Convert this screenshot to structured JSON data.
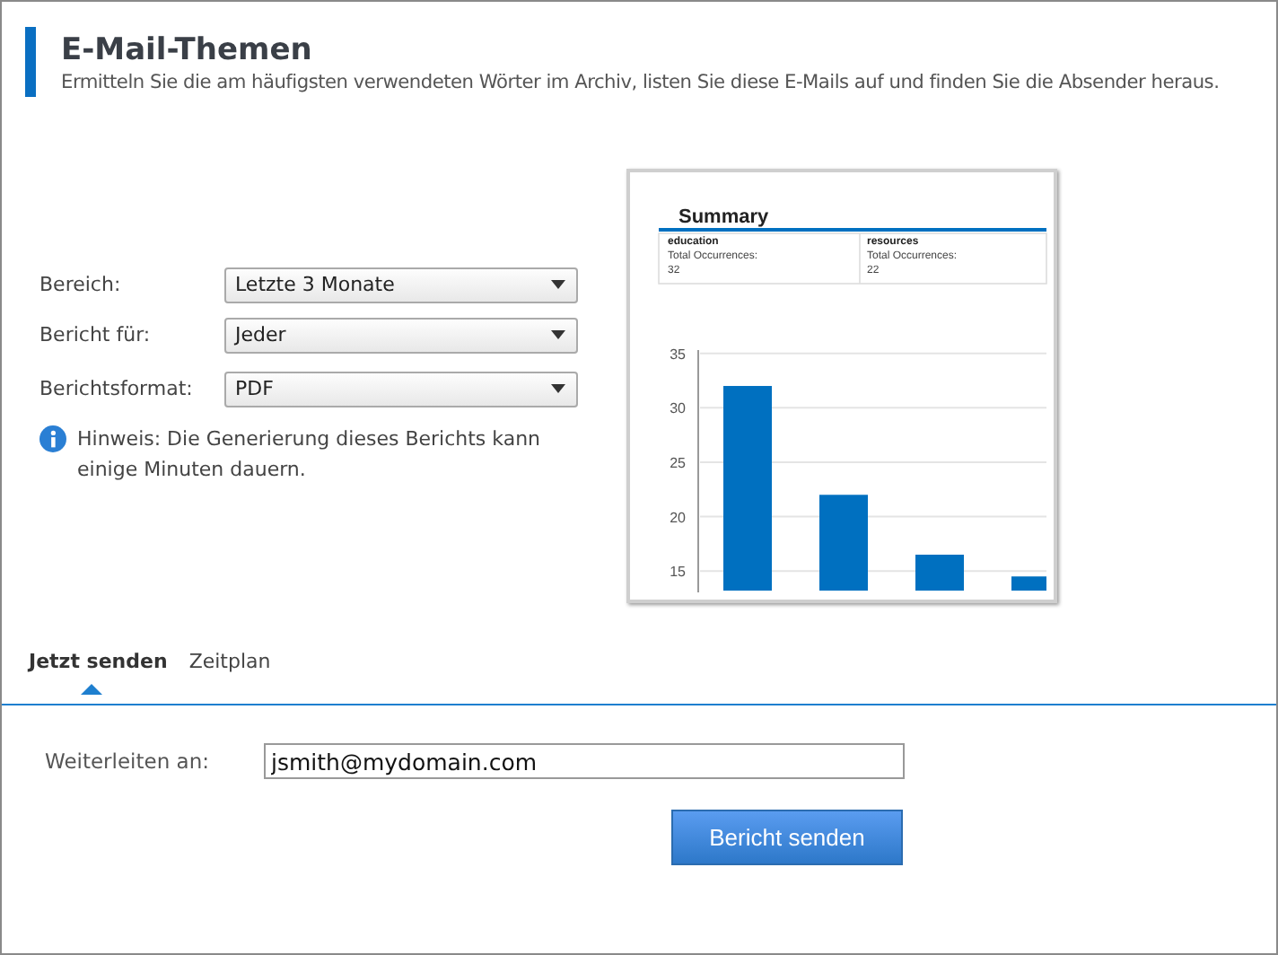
{
  "header": {
    "title": "E-Mail-Themen",
    "subtitle": "Ermitteln Sie die am häufigsten verwendeten Wörter im Archiv, listen Sie diese E-Mails auf und finden Sie die Absender heraus."
  },
  "form": [
    {
      "label": "Bereich:",
      "value": "Letzte 3 Monate"
    },
    {
      "label": "Bericht für:",
      "value": "Jeder"
    },
    {
      "label": "Berichtsformat:",
      "value": "PDF"
    }
  ],
  "hint": "Hinweis: Die Generierung dieses Berichts kann einige Minuten dauern.",
  "preview": {
    "title": "Summary",
    "cells": [
      {
        "term": "education",
        "label": "Total Occurrences:",
        "count": "32"
      },
      {
        "term": "resources",
        "label": "Total Occurrences:",
        "count": "22"
      }
    ],
    "chart_data": {
      "type": "bar",
      "values": [
        32,
        22,
        16.5,
        14.5
      ],
      "ylim": [
        13.2,
        35.3
      ],
      "yticks": [
        15,
        20,
        25,
        30,
        35
      ],
      "grid": true
    }
  },
  "tabs": [
    {
      "label": "Jetzt senden",
      "selected": true
    },
    {
      "label": "Zeitplan",
      "selected": false
    }
  ],
  "forward": {
    "label": "Weiterleiten an:",
    "value": "jsmith@mydomain.com"
  },
  "button": "Bericht senden"
}
